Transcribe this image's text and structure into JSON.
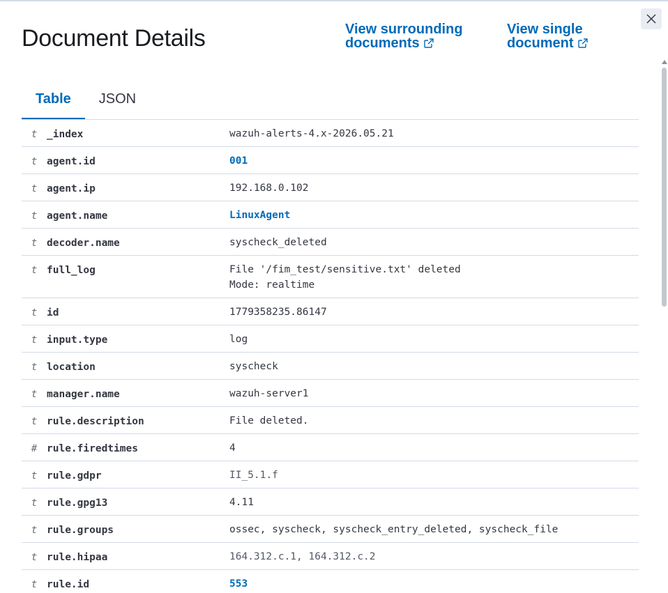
{
  "header": {
    "title": "Document Details",
    "link_surrounding_line1": "View surrounding",
    "link_surrounding_line2": "documents",
    "link_single_line1": "View single",
    "link_single_line2": "document"
  },
  "tabs": [
    {
      "label": "Table",
      "active": true
    },
    {
      "label": "JSON",
      "active": false
    }
  ],
  "rows": [
    {
      "type": "t",
      "field": "_index",
      "value": "wazuh-alerts-4.x-2026.05.21",
      "style": "plain"
    },
    {
      "type": "t",
      "field": "agent.id",
      "value": "001",
      "style": "link"
    },
    {
      "type": "t",
      "field": "agent.ip",
      "value": "192.168.0.102",
      "style": "plain"
    },
    {
      "type": "t",
      "field": "agent.name",
      "value": "LinuxAgent",
      "style": "link"
    },
    {
      "type": "t",
      "field": "decoder.name",
      "value": "syscheck_deleted",
      "style": "plain"
    },
    {
      "type": "t",
      "field": "full_log",
      "value": "File '/fim_test/sensitive.txt' deleted\nMode: realtime",
      "style": "plain"
    },
    {
      "type": "t",
      "field": "id",
      "value": "1779358235.86147",
      "style": "plain"
    },
    {
      "type": "t",
      "field": "input.type",
      "value": "log",
      "style": "plain"
    },
    {
      "type": "t",
      "field": "location",
      "value": "syscheck",
      "style": "plain"
    },
    {
      "type": "t",
      "field": "manager.name",
      "value": "wazuh-server1",
      "style": "plain"
    },
    {
      "type": "t",
      "field": "rule.description",
      "value": "File deleted.",
      "style": "plain"
    },
    {
      "type": "#",
      "field": "rule.firedtimes",
      "value": "4",
      "style": "plain"
    },
    {
      "type": "t",
      "field": "rule.gdpr",
      "value": "II_5.1.f",
      "style": "muted"
    },
    {
      "type": "t",
      "field": "rule.gpg13",
      "value": "4.11",
      "style": "plain"
    },
    {
      "type": "t",
      "field": "rule.groups",
      "value": "ossec, syscheck, syscheck_entry_deleted, syscheck_file",
      "style": "plain"
    },
    {
      "type": "t",
      "field": "rule.hipaa",
      "value": "164.312.c.1, 164.312.c.2",
      "style": "muted"
    },
    {
      "type": "t",
      "field": "rule.id",
      "value": "553",
      "style": "link"
    }
  ],
  "colors": {
    "accent": "#006bb8",
    "text": "#343741",
    "border": "#d3dae6"
  },
  "icons": {
    "close": "close-icon",
    "external": "external-link-icon"
  }
}
